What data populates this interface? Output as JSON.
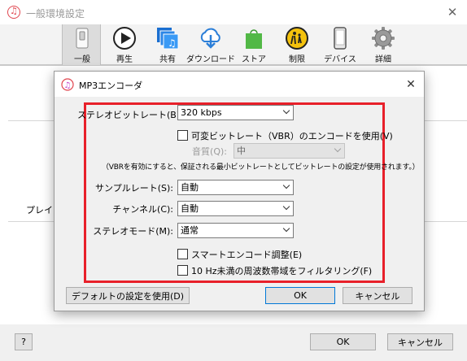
{
  "window": {
    "title": "一般環境設定",
    "close_glyph": "✕"
  },
  "toolbar": {
    "items": [
      {
        "label": "一般",
        "icon": "general-switch-icon",
        "active": true
      },
      {
        "label": "再生",
        "icon": "play-icon"
      },
      {
        "label": "共有",
        "icon": "sharing-icon"
      },
      {
        "label": "ダウンロード",
        "icon": "download-cloud-icon"
      },
      {
        "label": "ストア",
        "icon": "store-bag-icon"
      },
      {
        "label": "制限",
        "icon": "parental-restrictions-icon"
      },
      {
        "label": "デバイス",
        "icon": "device-phone-icon"
      },
      {
        "label": "詳細",
        "icon": "advanced-gear-icon"
      }
    ]
  },
  "background": {
    "partial_label": "プレイリ"
  },
  "main_footer": {
    "help_label": "?",
    "ok_label": "OK",
    "cancel_label": "キャンセル"
  },
  "dialog": {
    "title": "MP3エンコーダ",
    "close_glyph": "✕",
    "highlight_color": "#e8202a",
    "stereo_bitrate": {
      "label": "ステレオビットレート(B):",
      "value": "320 kbps"
    },
    "vbr": {
      "label": "可変ビットレート（VBR）のエンコードを使用(V)",
      "checked": false
    },
    "quality": {
      "label": "音質(Q):",
      "value": "中",
      "enabled": false
    },
    "vbr_note": "（VBRを有効にすると、保証される最小ビットレートとしてビットレートの設定が使用されます。）",
    "sample_rate": {
      "label": "サンプルレート(S):",
      "value": "自動"
    },
    "channel": {
      "label": "チャンネル(C):",
      "value": "自動"
    },
    "stereo_mode": {
      "label": "ステレオモード(M):",
      "value": "通常"
    },
    "smart_encode": {
      "label": "スマートエンコード調整(E)",
      "checked": false
    },
    "filter": {
      "label": "10 Hz未満の周波数帯域をフィルタリング(F)",
      "checked": false
    },
    "default_button": "デフォルトの設定を使用(D)",
    "ok_button": "OK",
    "cancel_button": "キャンセル"
  }
}
